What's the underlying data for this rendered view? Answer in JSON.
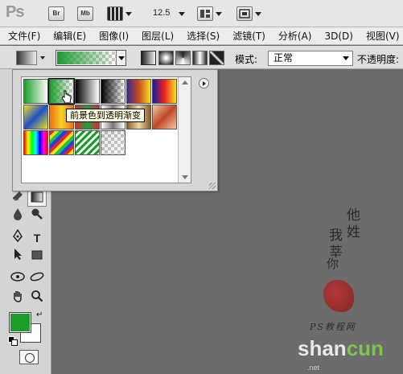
{
  "app": {
    "logo": "Ps",
    "buttons": [
      "Br",
      "Mb"
    ],
    "zoom": "12.5"
  },
  "menu": [
    "文件(F)",
    "编辑(E)",
    "图像(I)",
    "图层(L)",
    "选择(S)",
    "滤镜(T)",
    "分析(A)",
    "3D(D)",
    "视图(V)"
  ],
  "options": {
    "mode_label": "模式:",
    "mode_value": "正常",
    "opacity_label": "不透明度:"
  },
  "gradient_picker": {
    "tooltip": "前景色到透明渐变",
    "swatches": [
      "linear-gradient(90deg,#1a9d2a,#ffffff)",
      "linear-gradient(90deg,#1a9d2a,rgba(26,157,42,0))",
      "linear-gradient(90deg,#000,#fff)",
      "linear-gradient(90deg,#000,rgba(0,0,0,0))",
      "linear-gradient(90deg,#3a2a8c,#c84c1c,#f8e02a)",
      "linear-gradient(90deg,#1a1aa0,#f02020,#f8e020)",
      "linear-gradient(135deg,#f0e020,#2050c8,#f0e020)",
      "linear-gradient(90deg,#f07010,#f8d020,#f07010)",
      "linear-gradient(90deg,#d03030,#20a040,#d03030)",
      "linear-gradient(90deg,#fff,#777,#fff)",
      "linear-gradient(90deg,#8a5a2a,#f0d8a8,#8a5a2a)",
      "linear-gradient(135deg,#f0c8a0,#c04828,#f0c8a0)",
      "linear-gradient(90deg,#f00,#ff0,#0f0,#0ff,#00f,#f0f,#f00)",
      "repeating-linear-gradient(135deg,#f02020 0 4px,#f8e020 4px 8px,#20c040 8px 12px,#2040f0 12px 16px)",
      "repeating-linear-gradient(135deg,#1a9d2a 0 3px,#ffffff 3px 6px)",
      "linear-gradient(135deg,rgba(0,0,0,0.1),rgba(0,0,0,0))"
    ]
  },
  "tools": {
    "type_label": "T"
  },
  "watermark": {
    "cn_col1": "他姓",
    "cn_col2": "我莘",
    "cn_col3": "你",
    "site": "PS教程网",
    "brand_en": "shan",
    "brand_cn": "cun",
    "domain": ".net"
  }
}
